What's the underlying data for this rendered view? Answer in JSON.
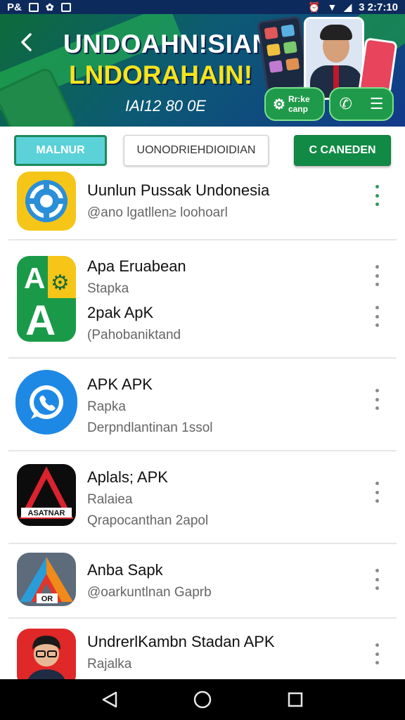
{
  "status_bar": {
    "left_text": "P&",
    "time": "3 2:7:10"
  },
  "hero": {
    "title": "UNDOAHN!SIAN",
    "subtitle": "LNDORAHAIN!",
    "date": "IAI12 80 0E",
    "app_button_label": "Rr:ke\ncanp",
    "colors": {
      "green": "#1f9a4a",
      "yellow": "#f4e41c",
      "navy": "#123a8a"
    }
  },
  "filters": {
    "chip_1": "MALNUR",
    "chip_2": "UONODRIEHDIOIDIAN",
    "chip_3": "C CANEDEN"
  },
  "apps": [
    {
      "title": "Uunlun Pussak Undonesia",
      "line2": "@ano lgatllen≥ loohoarl",
      "line3": "",
      "icon": "refresh-sync-icon"
    },
    {
      "title": "Apa Eruabean",
      "line2": "Stapka",
      "line3": "2pak ApK",
      "line4": "(Pahobaniktand",
      "icon": "letter-a-gear-icon"
    },
    {
      "title": "APK APK",
      "line2": "Rapka",
      "line3": "Derpndlantinan 1ssol",
      "icon": "phone-chat-icon"
    },
    {
      "title": "Aplals; APK",
      "line2": "Ralaiea",
      "line3": "Qrapocanthan 2apol",
      "icon": "red-triangle-logo-icon",
      "icon_text": "ASATNAR"
    },
    {
      "title": "Anba Sapk",
      "line2": "@oarkuntlnan Gaprb",
      "line3": "",
      "icon": "color-triangle-logo-icon",
      "icon_text": "OR"
    },
    {
      "title": "UndrerlKambn Stadan APK",
      "line2": "Rajalka",
      "line3": "",
      "icon": "person-avatar-icon"
    }
  ],
  "nav": {
    "back_icon": "back-triangle-icon",
    "home_icon": "home-circle-icon",
    "recents_icon": "recents-square-icon"
  }
}
